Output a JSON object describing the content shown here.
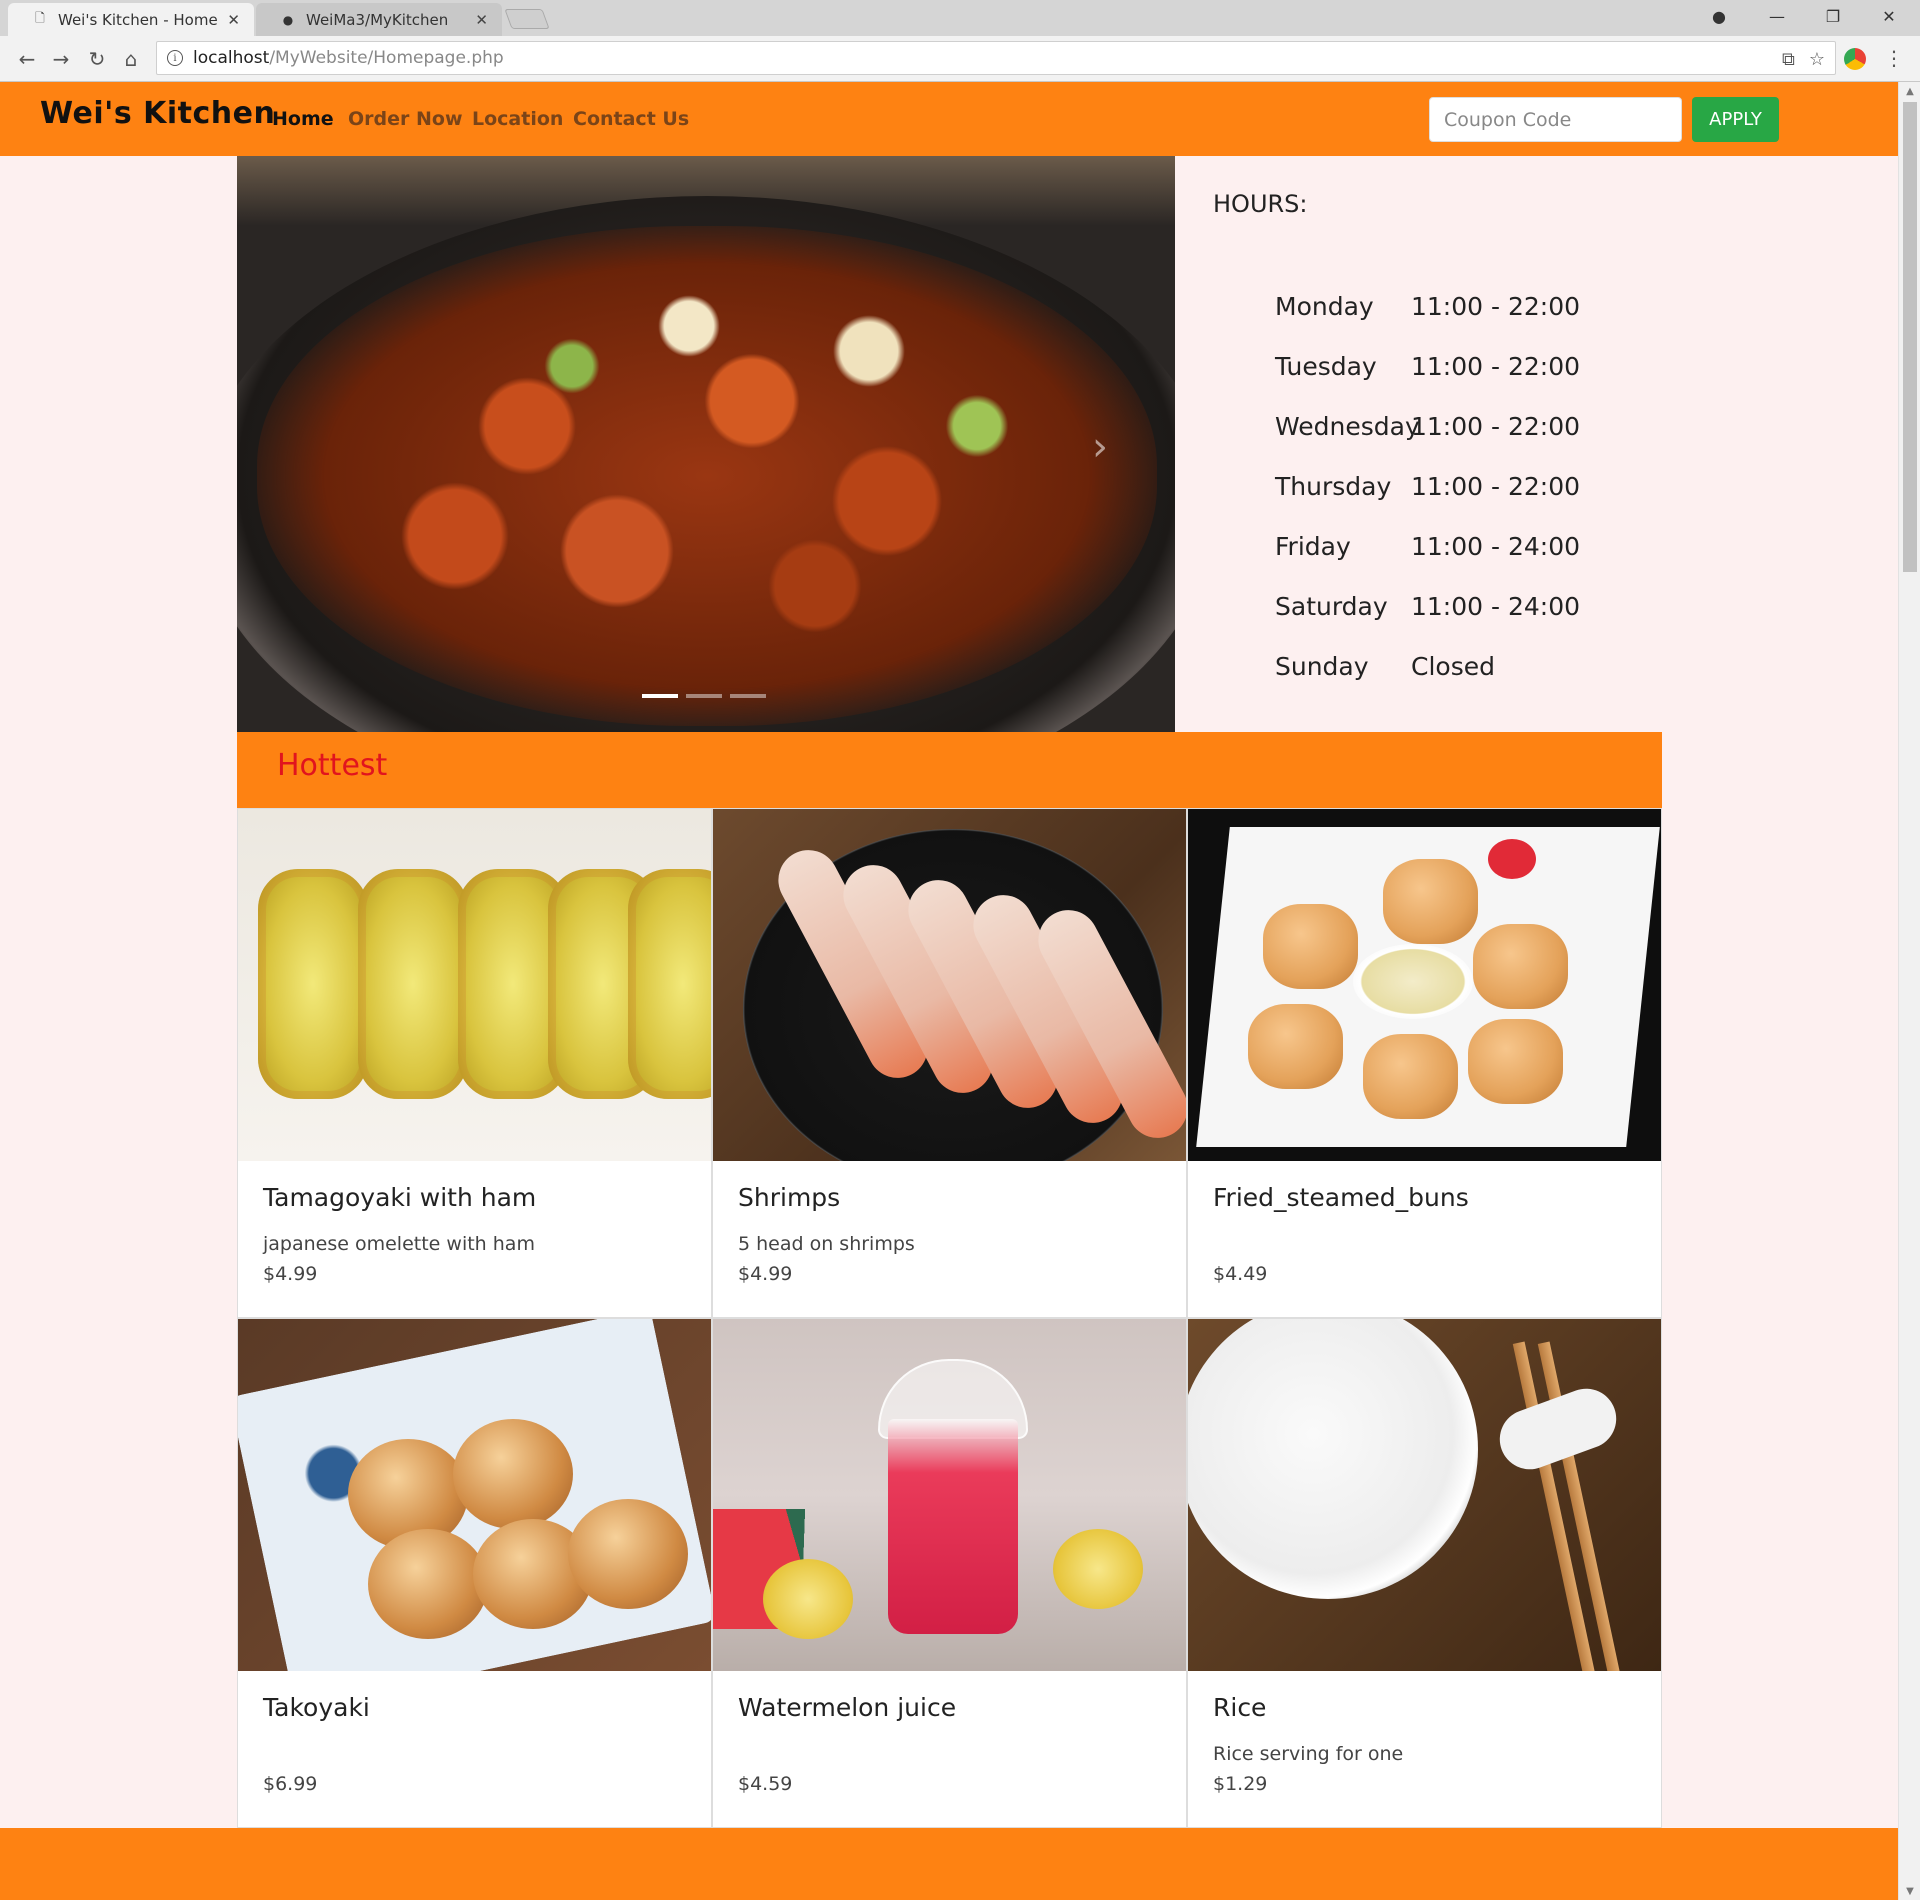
{
  "browser": {
    "tabs": [
      {
        "label": "Wei's Kitchen - Home",
        "active": true
      },
      {
        "label": "WeiMa3/MyKitchen",
        "active": false
      }
    ],
    "url_host": "localhost",
    "url_path": "/MyWebsite/Homepage.php"
  },
  "nav": {
    "brand": "Wei's Kitchen",
    "links": [
      "Home",
      "Order Now",
      "Location",
      "Contact Us"
    ],
    "coupon_placeholder": "Coupon Code",
    "apply_label": "APPLY"
  },
  "hours": {
    "title": "HOURS:",
    "rows": [
      {
        "day": "Monday",
        "time": "11:00 - 22:00"
      },
      {
        "day": "Tuesday",
        "time": "11:00 - 22:00"
      },
      {
        "day": "Wednesday",
        "time": "11:00 - 22:00"
      },
      {
        "day": "Thursday",
        "time": "11:00 - 22:00"
      },
      {
        "day": "Friday",
        "time": "11:00 - 24:00"
      },
      {
        "day": "Saturday",
        "time": "11:00 - 24:00"
      },
      {
        "day": "Sunday",
        "time": "Closed"
      }
    ]
  },
  "hottest": {
    "title": "Hottest",
    "items": [
      {
        "name": "Tamagoyaki with ham",
        "desc": "japanese omelette with ham",
        "price": "$4.99"
      },
      {
        "name": "Shrimps",
        "desc": "5 head on shrimps",
        "price": "$4.99"
      },
      {
        "name": "Fried_steamed_buns",
        "desc": "",
        "price": "$4.49"
      },
      {
        "name": "Takoyaki",
        "desc": "",
        "price": "$6.99"
      },
      {
        "name": "Watermelon juice",
        "desc": "",
        "price": "$4.59"
      },
      {
        "name": "Rice",
        "desc": "Rice serving for one",
        "price": "$1.29"
      }
    ]
  },
  "colors": {
    "brand_orange": "#fe8212",
    "apply_green": "#28a745",
    "hottest_red": "#e1141e",
    "page_bg": "#fdf0f0"
  }
}
